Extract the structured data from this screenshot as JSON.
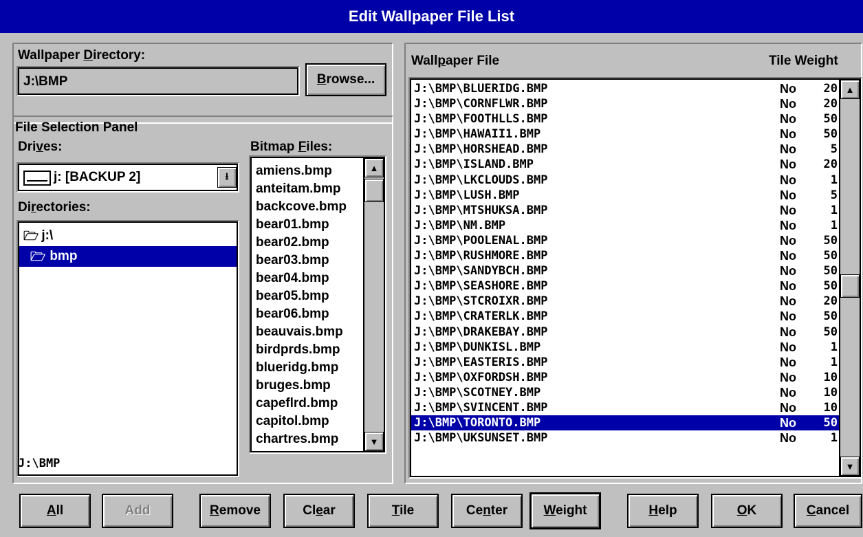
{
  "window": {
    "title": "Edit Wallpaper File List"
  },
  "wallpaper_directory": {
    "label": "Wallpaper Directory:",
    "value": "J:\\BMP",
    "browse_button": "Browse..."
  },
  "file_panel": {
    "title": "File Selection Panel",
    "drives_label": "Drives:",
    "drive_value": "j: [BACKUP 2]",
    "directories_label": "Directories:",
    "directories": [
      {
        "name": "j:\\",
        "selected": false
      },
      {
        "name": "bmp",
        "selected": true
      }
    ],
    "bitmap_files_label": "Bitmap Files:",
    "bitmap_files": [
      "amiens.bmp",
      "anteitam.bmp",
      "backcove.bmp",
      "bear01.bmp",
      "bear02.bmp",
      "bear03.bmp",
      "bear04.bmp",
      "bear05.bmp",
      "bear06.bmp",
      "beauvais.bmp",
      "birdprds.bmp",
      "blueridg.bmp",
      "bruges.bmp",
      "capeflrd.bmp",
      "capitol.bmp",
      "chartres.bmp"
    ],
    "current_path": "J:\\BMP"
  },
  "wallpaper_list": {
    "header_file": "Wallpaper File",
    "header_tile_weight": "Tile Weight",
    "rows": [
      {
        "path": "J:\\BMP\\BLUERIDG.BMP",
        "tile": "No",
        "weight": "20"
      },
      {
        "path": "J:\\BMP\\CORNFLWR.BMP",
        "tile": "No",
        "weight": "20"
      },
      {
        "path": "J:\\BMP\\FOOTHLLS.BMP",
        "tile": "No",
        "weight": "50"
      },
      {
        "path": "J:\\BMP\\HAWAII1.BMP",
        "tile": "No",
        "weight": "50"
      },
      {
        "path": "J:\\BMP\\HORSHEAD.BMP",
        "tile": "No",
        "weight": "5"
      },
      {
        "path": "J:\\BMP\\ISLAND.BMP",
        "tile": "No",
        "weight": "20"
      },
      {
        "path": "J:\\BMP\\LKCLOUDS.BMP",
        "tile": "No",
        "weight": "1"
      },
      {
        "path": "J:\\BMP\\LUSH.BMP",
        "tile": "No",
        "weight": "5"
      },
      {
        "path": "J:\\BMP\\MTSHUKSA.BMP",
        "tile": "No",
        "weight": "1"
      },
      {
        "path": "J:\\BMP\\NM.BMP",
        "tile": "No",
        "weight": "1"
      },
      {
        "path": "J:\\BMP\\POOLENAL.BMP",
        "tile": "No",
        "weight": "50"
      },
      {
        "path": "J:\\BMP\\RUSHMORE.BMP",
        "tile": "No",
        "weight": "50"
      },
      {
        "path": "J:\\BMP\\SANDYBCH.BMP",
        "tile": "No",
        "weight": "50"
      },
      {
        "path": "J:\\BMP\\SEASHORE.BMP",
        "tile": "No",
        "weight": "50"
      },
      {
        "path": "J:\\BMP\\STCROIXR.BMP",
        "tile": "No",
        "weight": "20"
      },
      {
        "path": "J:\\BMP\\CRATERLK.BMP",
        "tile": "No",
        "weight": "50"
      },
      {
        "path": "J:\\BMP\\DRAKEBAY.BMP",
        "tile": "No",
        "weight": "50"
      },
      {
        "path": "J:\\BMP\\DUNKISL.BMP",
        "tile": "No",
        "weight": "1"
      },
      {
        "path": "J:\\BMP\\EASTERIS.BMP",
        "tile": "No",
        "weight": "1"
      },
      {
        "path": "J:\\BMP\\OXFORDSH.BMP",
        "tile": "No",
        "weight": "10"
      },
      {
        "path": "J:\\BMP\\SCOTNEY.BMP",
        "tile": "No",
        "weight": "10"
      },
      {
        "path": "J:\\BMP\\SVINCENT.BMP",
        "tile": "No",
        "weight": "10"
      },
      {
        "path": "J:\\BMP\\TORONTO.BMP",
        "tile": "No",
        "weight": "50",
        "selected": true
      },
      {
        "path": "J:\\BMP\\UKSUNSET.BMP",
        "tile": "No",
        "weight": "1"
      }
    ],
    "scroll_position": 0.52
  },
  "buttons": {
    "all": "All",
    "add": "Add",
    "remove": "Remove",
    "clear": "Clear",
    "tile": "Tile",
    "center": "Center",
    "weight": "Weight",
    "help": "Help",
    "ok": "OK",
    "cancel": "Cancel"
  },
  "colors": {
    "face": "#c0c0c0",
    "selection": "#0000a8",
    "title_bar": "#0000a8"
  }
}
